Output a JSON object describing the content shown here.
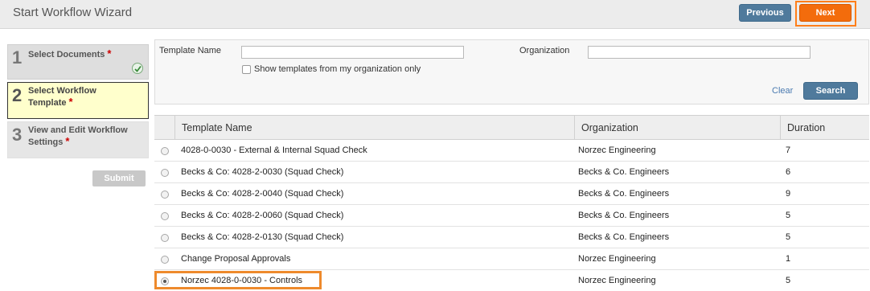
{
  "header": {
    "title": "Start Workflow Wizard",
    "previous_label": "Previous",
    "next_label": "Next"
  },
  "steps": [
    {
      "number": "1",
      "label": "Select Documents",
      "required": "*",
      "completed": true
    },
    {
      "number": "2",
      "label": "Select Workflow Template",
      "required": "*",
      "active": true
    },
    {
      "number": "3",
      "label": "View and Edit Workflow Settings",
      "required": "*"
    }
  ],
  "submit_label": "Submit",
  "filter": {
    "template_name_label": "Template Name",
    "template_name_value": "",
    "organization_label": "Organization",
    "organization_value": "",
    "org_only_label": "Show templates from my organization only",
    "clear_label": "Clear",
    "search_label": "Search"
  },
  "table": {
    "columns": [
      "Template Name",
      "Organization",
      "Duration"
    ],
    "rows": [
      {
        "name": "4028-0-0030 - External & Internal Squad Check",
        "org": "Norzec Engineering",
        "duration": "7",
        "selected": false
      },
      {
        "name": "Becks & Co: 4028-2-0030 (Squad Check)",
        "org": "Becks & Co. Engineers",
        "duration": "6",
        "selected": false
      },
      {
        "name": "Becks & Co: 4028-2-0040 (Squad Check)",
        "org": "Becks & Co. Engineers",
        "duration": "9",
        "selected": false
      },
      {
        "name": "Becks & Co: 4028-2-0060 (Squad Check)",
        "org": "Becks & Co. Engineers",
        "duration": "5",
        "selected": false
      },
      {
        "name": "Becks & Co: 4028-2-0130 (Squad Check)",
        "org": "Becks & Co. Engineers",
        "duration": "5",
        "selected": false
      },
      {
        "name": "Change Proposal Approvals",
        "org": "Norzec Engineering",
        "duration": "1",
        "selected": false
      },
      {
        "name": "Norzec 4028-0-0030 - Controls",
        "org": "Norzec Engineering",
        "duration": "5",
        "selected": true
      }
    ]
  },
  "colors": {
    "primary_button": "#4f7a9c",
    "next_button": "#f36c0c",
    "highlight_outline": "#ee8a2c",
    "active_step_bg": "#ffffcc",
    "required_star": "#cc0000"
  }
}
